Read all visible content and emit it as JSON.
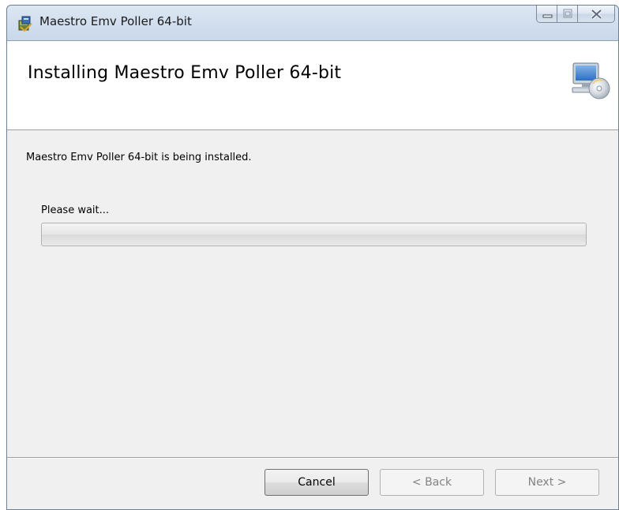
{
  "window": {
    "title": "Maestro Emv Poller 64-bit",
    "icon": "installer-package-icon"
  },
  "caption_buttons": {
    "minimize": "minimize-icon",
    "maximize": "maximize-icon",
    "close": "close-icon"
  },
  "header": {
    "title": "Installing Maestro Emv Poller 64-bit",
    "icon": "computer-disc-icon"
  },
  "body": {
    "status_text": "Maestro Emv Poller 64-bit is being installed.",
    "wait_label": "Please wait...",
    "progress_fraction": 0
  },
  "buttons": {
    "cancel_label": "Cancel",
    "back_label": "< Back",
    "next_label": "Next >"
  }
}
